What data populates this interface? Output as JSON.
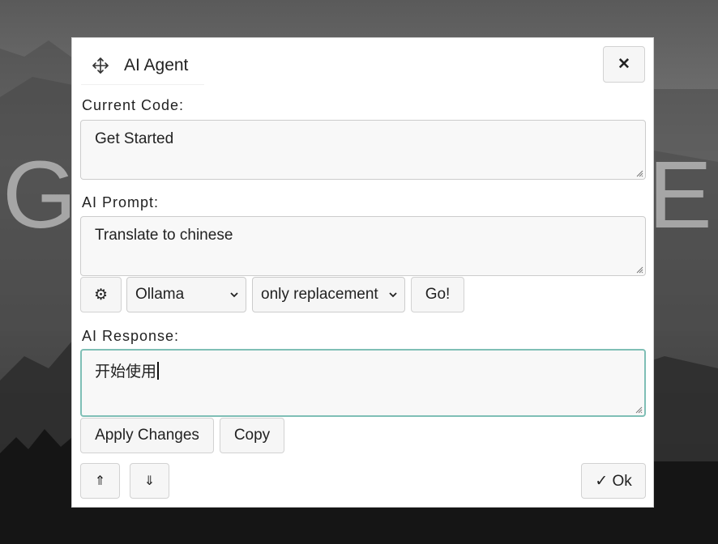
{
  "background": {
    "word_left": "G",
    "word_right": "E"
  },
  "dialog": {
    "title": "AI Agent",
    "move_icon": "move-arrows-icon",
    "close_label": "✕"
  },
  "current_code": {
    "label": "Current Code:",
    "value": "Get Started"
  },
  "ai_prompt": {
    "label": "AI Prompt:",
    "value": "Translate to chinese"
  },
  "controls": {
    "settings_icon": "⚙",
    "provider_selected": "Ollama",
    "mode_selected": "only replacement",
    "go_label": "Go!"
  },
  "ai_response": {
    "label": "AI Response:",
    "value": "开始使用"
  },
  "actions": {
    "apply_label": "Apply Changes",
    "copy_label": "Copy",
    "up_label": "⇑",
    "down_label": "⇓",
    "ok_label": "✓ Ok"
  },
  "colors": {
    "focus_border": "#7fbfb6",
    "button_bg": "#f6f6f6"
  }
}
